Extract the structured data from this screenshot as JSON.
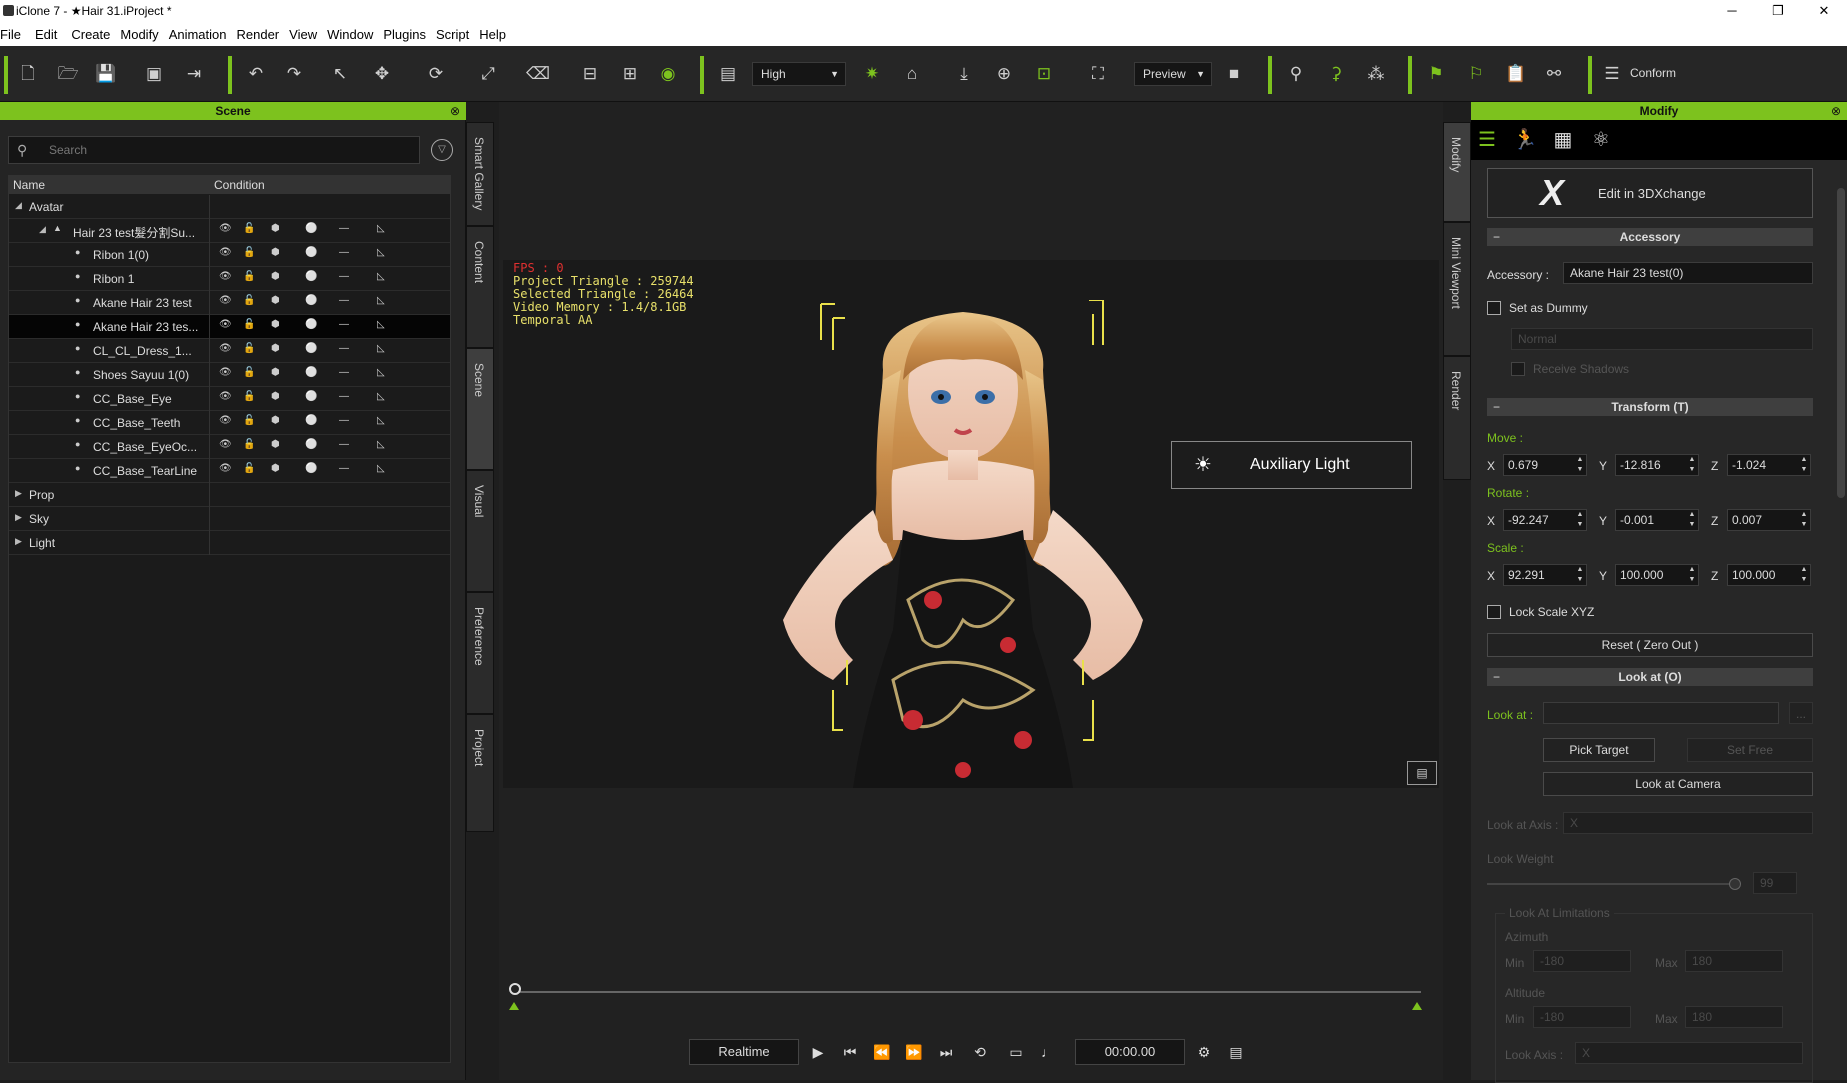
{
  "window": {
    "title": "iClone 7 - ★Hair 31.iProject *",
    "controls": [
      "─",
      "❐",
      "✕"
    ]
  },
  "menu": [
    "File",
    "Edit",
    "Create",
    "Modify",
    "Animation",
    "Render",
    "View",
    "Window",
    "Plugins",
    "Script",
    "Help"
  ],
  "toolbar": {
    "quality": "High",
    "preview": "Preview",
    "conform": "Conform"
  },
  "scene_panel": {
    "title": "Scene",
    "search_placeholder": "Search",
    "columns": [
      "Name",
      "Condition"
    ],
    "rows": [
      {
        "label": "Avatar",
        "level": 0,
        "expanded": true
      },
      {
        "label": "Hair 23 test髮分割Su...",
        "level": 1,
        "expanded": true
      },
      {
        "label": "Ribon 1(0)",
        "level": 2
      },
      {
        "label": "Ribon 1",
        "level": 2
      },
      {
        "label": "Akane Hair 23 test",
        "level": 2
      },
      {
        "label": "Akane Hair 23 tes...",
        "level": 2,
        "selected": true
      },
      {
        "label": "CL_CL_Dress_1...",
        "level": 2
      },
      {
        "label": "Shoes Sayuu 1(0)",
        "level": 2
      },
      {
        "label": "CC_Base_Eye",
        "level": 2
      },
      {
        "label": "CC_Base_Teeth",
        "level": 2
      },
      {
        "label": "CC_Base_EyeOc...",
        "level": 2
      },
      {
        "label": "CC_Base_TearLine",
        "level": 2
      },
      {
        "label": "Prop",
        "level": 0
      },
      {
        "label": "Sky",
        "level": 0
      },
      {
        "label": "Light",
        "level": 0
      }
    ]
  },
  "side_tabs": [
    "Smart Gallery",
    "Content",
    "Scene",
    "Visual",
    "Preference",
    "Project"
  ],
  "viewport": {
    "stats": {
      "fps": "FPS : 0",
      "triangles": "Project Triangle : 259744",
      "selected": "Selected Triangle : 26464",
      "memory": "Video Memory : 1.4/8.1GB",
      "aa": "Temporal AA"
    },
    "aux_light": "Auxiliary Light",
    "playback_mode": "Realtime",
    "time": "00:00.00"
  },
  "right_tabs": [
    "Modify",
    "Mini Viewport",
    "Render"
  ],
  "modify_panel": {
    "title": "Modify",
    "edit_3dx": "Edit in 3DXchange",
    "accessory_section": "Accessory",
    "accessory_label": "Accessory :",
    "accessory_value": "Akane Hair 23 test(0)",
    "set_dummy": "Set as Dummy",
    "normal": "Normal",
    "receive_shadows": "Receive Shadows",
    "transform_section": "Transform  (T)",
    "move_label": "Move :",
    "rotate_label": "Rotate :",
    "scale_label": "Scale :",
    "move": {
      "x": "0.679",
      "y": "-12.816",
      "z": "-1.024"
    },
    "rotate": {
      "x": "-92.247",
      "y": "-0.001",
      "z": "0.007"
    },
    "scale": {
      "x": "92.291",
      "y": "100.000",
      "z": "100.000"
    },
    "axis": {
      "x": "X",
      "y": "Y",
      "z": "Z"
    },
    "lock_scale": "Lock Scale XYZ",
    "reset": "Reset ( Zero Out )",
    "lookat_section": "Look at  (O)",
    "lookat_label": "Look at :",
    "browse": "...",
    "pick_target": "Pick Target",
    "set_free": "Set Free",
    "look_camera": "Look at Camera",
    "lookat_axis_label": "Look at Axis :",
    "lookat_axis_value": "X",
    "look_weight_label": "Look Weight",
    "look_weight_value": 99,
    "limitations": "Look At Limitations",
    "azimuth": "Azimuth",
    "altitude": "Altitude",
    "min_label": "Min",
    "max_label": "Max",
    "az_min": "-180",
    "az_max": "180",
    "alt_min": "-180",
    "alt_max": "180",
    "look_axis_label": "Look Axis :",
    "look_axis_value": "X"
  }
}
